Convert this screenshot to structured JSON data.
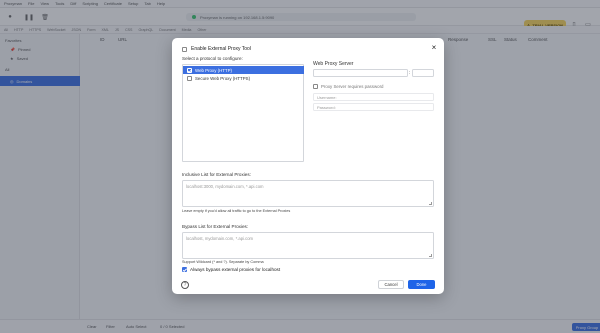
{
  "app": {
    "menu": [
      "Proxyman",
      "File",
      "View",
      "Tools",
      "Diff",
      "Scripting",
      "Certificate",
      "Setup",
      "Tab",
      "Help"
    ],
    "status_text": "Proxyman is running on 192.168.1.5:9090",
    "trial_badge": "TRIAL VERSION",
    "filters": [
      "All",
      "HTTP",
      "HTTPS",
      "WebSocket",
      "JSON",
      "Form",
      "XML",
      "JS",
      "CSS",
      "GraphQL",
      "Document",
      "Media",
      "Other"
    ],
    "sidebar": {
      "favorites_header": "Favorites",
      "favorites": [
        "Pinned",
        "Saved"
      ],
      "all_header": "All",
      "active_item": "Domains"
    },
    "table_headers": [
      "ID",
      "URL",
      "Response",
      "SSL",
      "Status",
      "Comment"
    ],
    "bottom": [
      "Clear",
      "Filter",
      "Auto Select",
      "0 / 0 Selected"
    ],
    "bottom_button": "Proxy Group"
  },
  "dialog": {
    "enable_label": "Enable External Proxy Tool",
    "protocol_label": "Select a protocol to configure:",
    "protocols": [
      {
        "label": "Web Proxy (HTTP)",
        "checked": true,
        "selected": true
      },
      {
        "label": "Secure Web Proxy (HTTPS)",
        "checked": false,
        "selected": false
      }
    ],
    "server_label": "Web Proxy Server",
    "server_host": "",
    "port_separator": ":",
    "server_port": "",
    "requires_password_label": "Proxy Server requires password",
    "username_placeholder": "Username:",
    "password_placeholder": "Password:",
    "inclusive_label": "Inclusive List for External Proxies:",
    "inclusive_placeholder": "localhost:3000, mydomain.com, *.api.com",
    "inclusive_hint": "Leave empty if you'd allow all traffic to go to the External Proxies",
    "bypass_label": "Bypass List for External Proxies:",
    "bypass_placeholder": "localhost, mydomain.com, *.api.com",
    "bypass_hint": "Support Wildcard (* and ?). Separate by Comma",
    "always_bypass_label": "Always bypass external proxies for localhost",
    "help_glyph": "?",
    "cancel_label": "Cancel",
    "done_label": "Done",
    "colors": {
      "accent": "#1e64e8",
      "selection": "#3c6fe0"
    }
  }
}
